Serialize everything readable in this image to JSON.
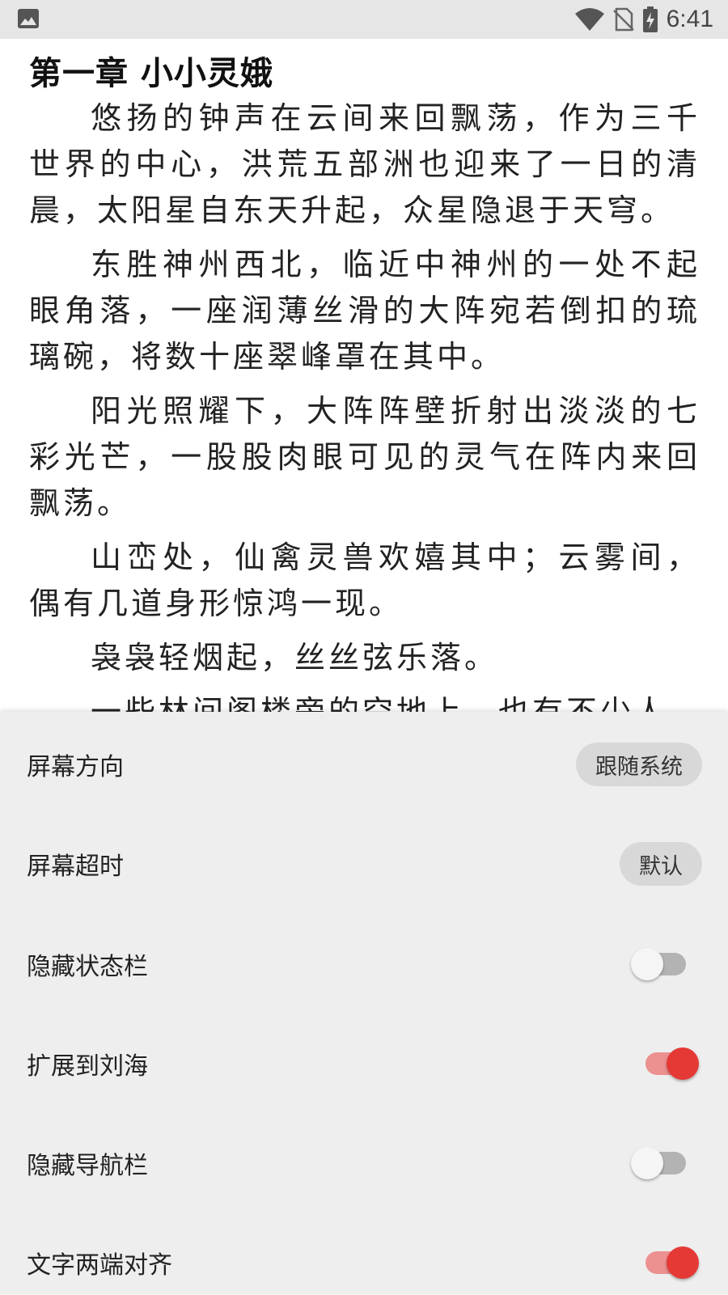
{
  "status_bar": {
    "time": "6:41",
    "icons": [
      "image-icon",
      "wifi-icon",
      "no-sim-icon",
      "battery-charging-icon"
    ]
  },
  "reader": {
    "chapter_title": "第一章 小小灵娥",
    "paragraphs": [
      "悠扬的钟声在云间来回飘荡，作为三千世界的中心，洪荒五部洲也迎来了一日的清晨，太阳星自东天升起，众星隐退于天穹。",
      "东胜神州西北，临近中神州的一处不起眼角落，一座润薄丝滑的大阵宛若倒扣的琉璃碗，将数十座翠峰罩在其中。",
      "阳光照耀下，大阵阵壁折射出淡淡的七彩光芒，一股股肉眼可见的灵气在阵内来回飘荡。",
      "山峦处，仙禽灵兽欢嬉其中；云雾间，偶有几道身形惊鸿一现。",
      "袅袅轻烟起，丝丝弦乐落。",
      "一些林间阁楼旁的空地上，也有不少人"
    ]
  },
  "settings": {
    "screen_orientation": {
      "label": "屏幕方向",
      "value": "跟随系统"
    },
    "screen_timeout": {
      "label": "屏幕超时",
      "value": "默认"
    },
    "hide_status_bar": {
      "label": "隐藏状态栏",
      "checked": false
    },
    "extend_to_notch": {
      "label": "扩展到刘海",
      "checked": true
    },
    "hide_nav_bar": {
      "label": "隐藏导航栏",
      "checked": false
    },
    "text_justify": {
      "label": "文字两端对齐",
      "checked": true
    }
  },
  "colors": {
    "accent": "#e53935",
    "accent_track": "#ec9090",
    "panel_bg": "#eeeeee",
    "status_bar_bg": "#e6e6e6"
  }
}
